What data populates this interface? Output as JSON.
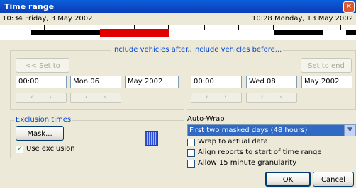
{
  "window": {
    "title": "Time range"
  },
  "timeline": {
    "start_label": "10:34 Friday, 3 May 2002",
    "end_label": "10:28 Monday, 13 May 2002"
  },
  "after": {
    "title": "Include vehicles after...",
    "set_button": "<< Set to start",
    "time": "00:00",
    "day": "Mon 06",
    "month": "May 2002"
  },
  "before": {
    "title": "Include vehicles before...",
    "set_button": "Set to end >>",
    "time": "00:00",
    "day": "Wed 08",
    "month": "May 2002"
  },
  "exclusion": {
    "title": "Exclusion times",
    "mask_button": "Mask...",
    "use_exclusion_label": "Use exclusion",
    "use_exclusion_checked": true
  },
  "autowrap": {
    "label": "Auto-Wrap",
    "selected": "First two masked days (48 hours)",
    "options": [
      {
        "label": "Wrap to actual data",
        "checked": false
      },
      {
        "label": "Align reports to start of time range",
        "checked": false
      },
      {
        "label": "Allow 15 minute granularity",
        "checked": false
      }
    ]
  },
  "buttons": {
    "ok": "OK",
    "cancel": "Cancel"
  },
  "icons": {
    "close": "close-icon",
    "grid": "grid-icon"
  }
}
